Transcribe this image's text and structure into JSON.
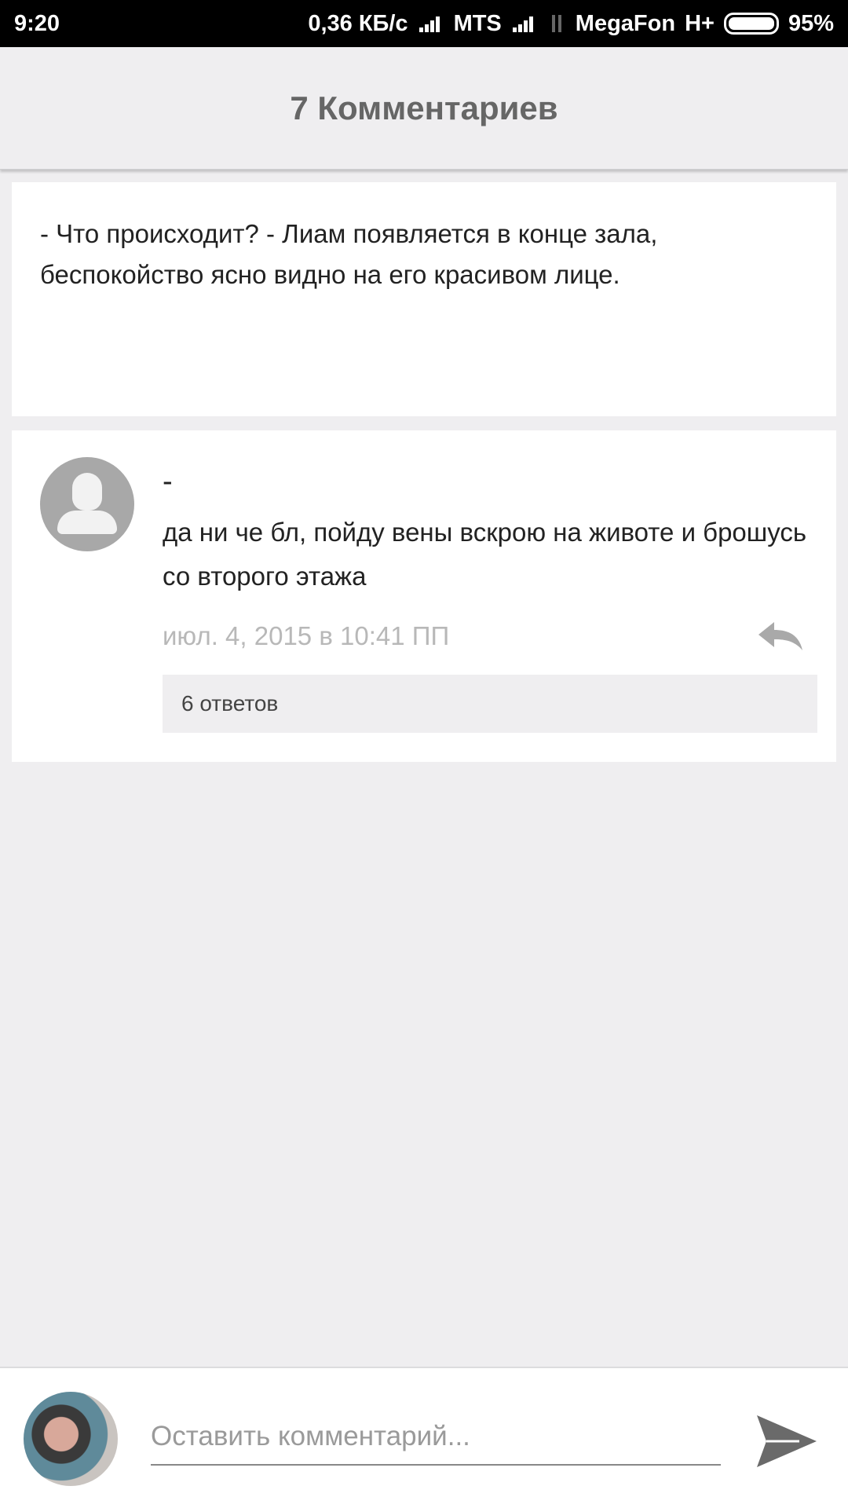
{
  "status_bar": {
    "time": "9:20",
    "net_speed": "0,36 КБ/с",
    "carrier1": "MTS",
    "carrier2": "MegaFon",
    "network_type": "H+",
    "battery": "95%"
  },
  "header": {
    "title": "7 Комментариев"
  },
  "excerpt": {
    "text": "- Что происходит? - Лиам появляется в конце зала, беспокойство ясно видно на его красивом лице."
  },
  "comment": {
    "author": "-",
    "text": "да ни че бл, пойду вены вскрою на животе и брошусь со второго этажа",
    "date": "июл. 4, 2015 в 10:41 ПП",
    "replies_label": "6 ответов",
    "reply_icon": "reply-arrow-icon"
  },
  "composer": {
    "placeholder": "Оставить комментарий...",
    "send_icon": "send-icon"
  },
  "colors": {
    "background": "#efeef0",
    "header_text": "#666666",
    "date_text": "#b8b8b8"
  }
}
